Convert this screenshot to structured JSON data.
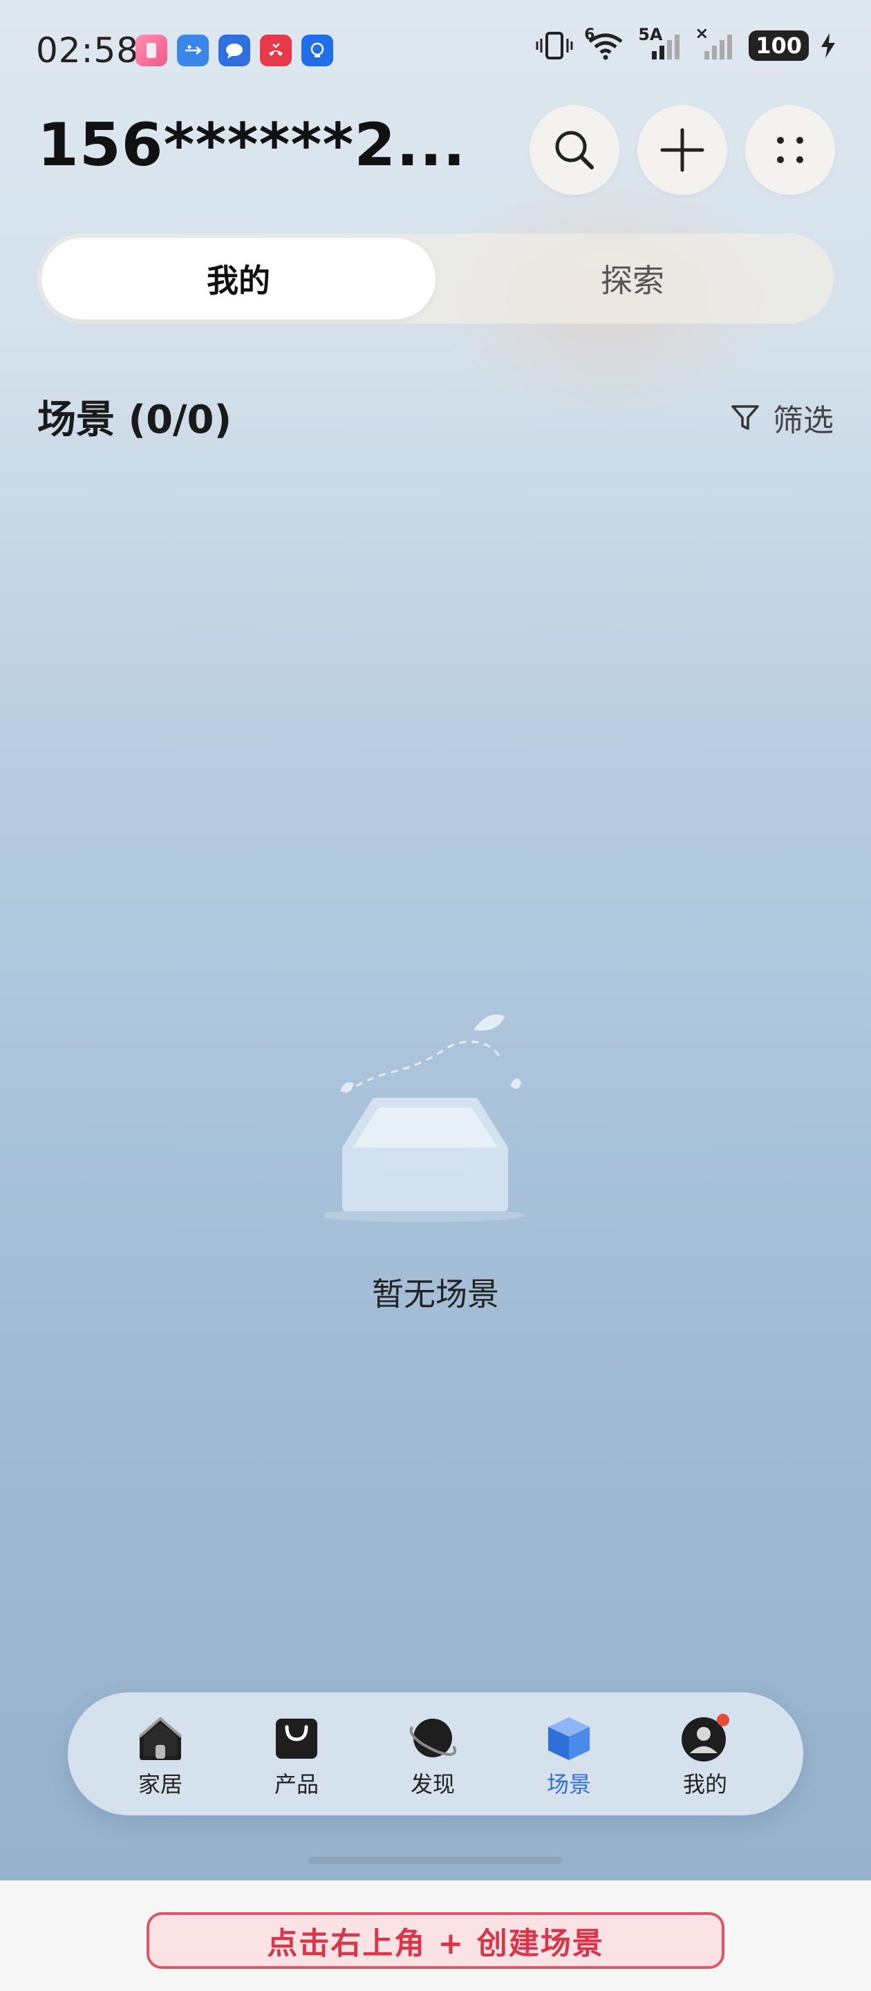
{
  "status_bar": {
    "time": "02:58",
    "network_5g": "5A",
    "wifi_label": "6",
    "battery": "100"
  },
  "header": {
    "account": "156******2..."
  },
  "tabs": [
    {
      "label": "我的",
      "active": true
    },
    {
      "label": "探索",
      "active": false
    }
  ],
  "section": {
    "title": "场景 (0/0)",
    "filter_label": "筛选"
  },
  "empty_state": {
    "message": "暂无场景"
  },
  "bottom_nav": [
    {
      "label": "家居",
      "icon": "home-icon",
      "active": false
    },
    {
      "label": "产品",
      "icon": "shopping-bag-icon",
      "active": false
    },
    {
      "label": "发现",
      "icon": "planet-icon",
      "active": false
    },
    {
      "label": "场景",
      "icon": "cube-icon",
      "active": true
    },
    {
      "label": "我的",
      "icon": "profile-icon",
      "active": false
    }
  ],
  "hint": {
    "text": "点击右上角 + 创建场景"
  },
  "colors": {
    "accent": "#2f6fd6",
    "hint_red": "#d9364a"
  }
}
